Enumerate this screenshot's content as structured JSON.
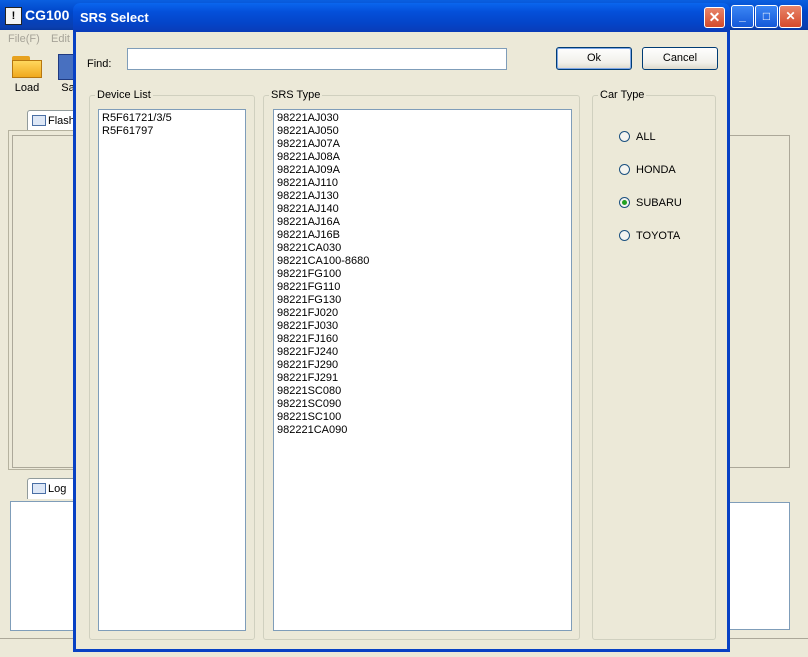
{
  "background_app": {
    "title": "CG100 I",
    "menu": [
      "File(F)",
      "Edit"
    ],
    "toolbar": [
      "Load",
      "Sa"
    ],
    "tabs": {
      "flash": "Flash",
      "log": "Log"
    }
  },
  "dialog": {
    "title": "SRS Select",
    "find_label": "Find:",
    "find_value": "",
    "ok_label": "Ok",
    "cancel_label": "Cancel",
    "device_list": {
      "label": "Device List",
      "items": [
        "R5F61721/3/5",
        "R5F61797"
      ]
    },
    "srs_type": {
      "label": "SRS Type",
      "items": [
        "98221AJ030",
        "98221AJ050",
        "98221AJ07A",
        "98221AJ08A",
        "98221AJ09A",
        "98221AJ110",
        "98221AJ130",
        "98221AJ140",
        "98221AJ16A",
        "98221AJ16B",
        "98221CA030",
        "98221CA100-8680",
        "98221FG100",
        "98221FG110",
        "98221FG130",
        "98221FJ020",
        "98221FJ030",
        "98221FJ160",
        "98221FJ240",
        "98221FJ290",
        "98221FJ291",
        "98221SC080",
        "98221SC090",
        "98221SC100",
        "982221CA090"
      ]
    },
    "car_type": {
      "label": "Car Type",
      "options": [
        {
          "label": "ALL",
          "checked": false
        },
        {
          "label": "HONDA",
          "checked": false
        },
        {
          "label": "SUBARU",
          "checked": true
        },
        {
          "label": "TOYOTA",
          "checked": false
        }
      ]
    }
  }
}
